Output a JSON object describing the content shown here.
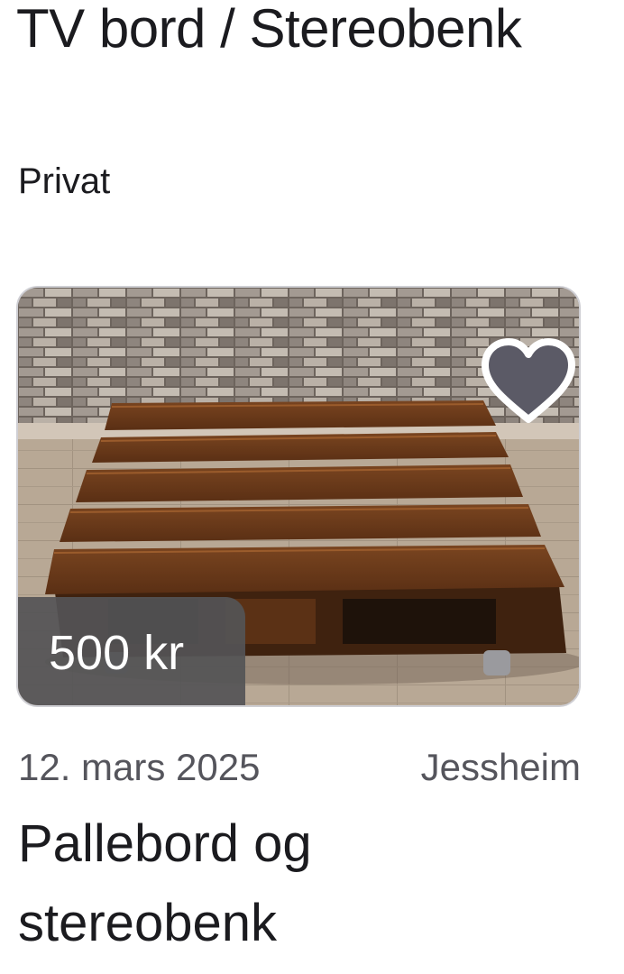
{
  "category": {
    "title": "TV bord / Stereobenk"
  },
  "seller": {
    "type": "Privat"
  },
  "listing": {
    "price": "500 kr",
    "date": "12. mars 2025",
    "location": "Jessheim",
    "title": "Pallebord og stereobenk",
    "favorite_icon": "heart-icon",
    "favorited": false
  },
  "colors": {
    "heart_fill": "#5b5a66",
    "heart_stroke": "#ffffff",
    "badge_bg": "#545456"
  }
}
